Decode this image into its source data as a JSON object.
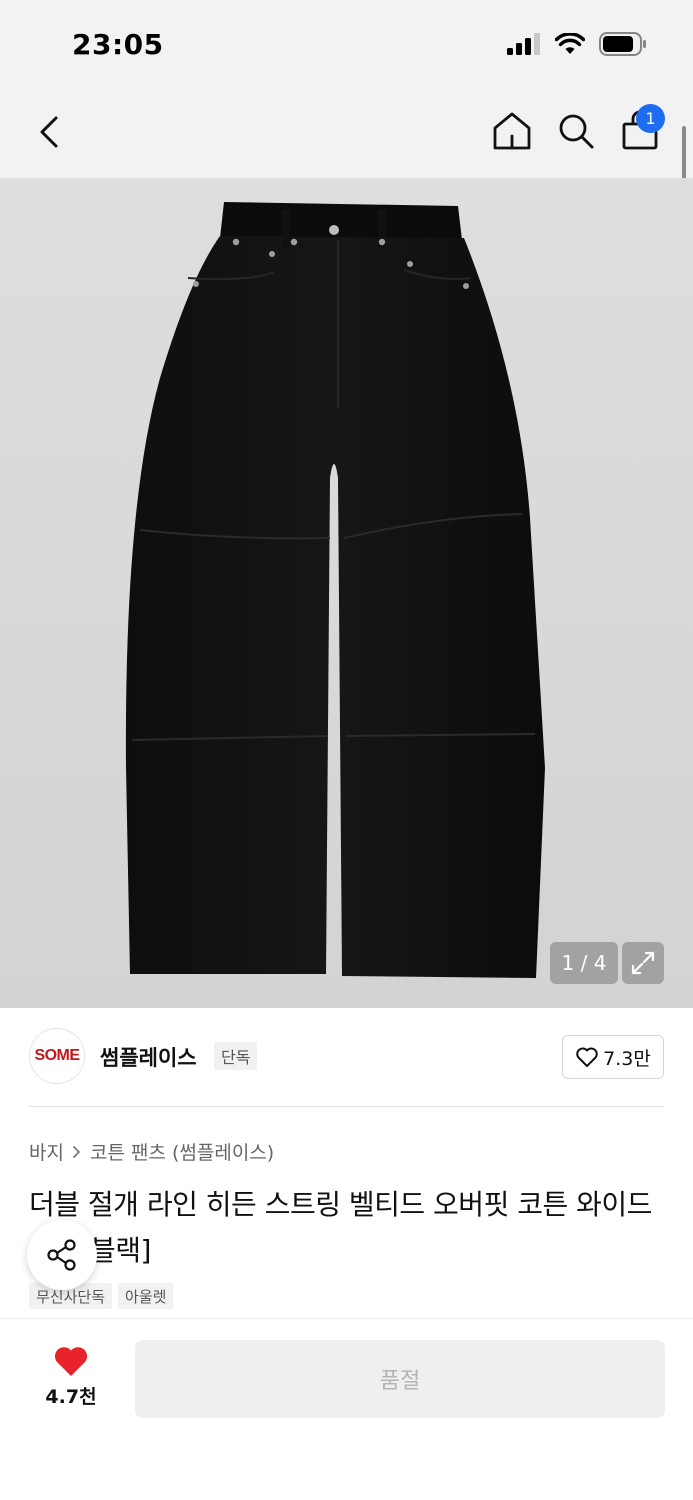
{
  "status_bar": {
    "time": "23:05"
  },
  "nav": {
    "cart_badge": "1"
  },
  "gallery": {
    "counter": "1 / 4"
  },
  "brand": {
    "logo_text": "SOME",
    "name": "썸플레이스",
    "tag": "단독",
    "likes": "7.3만"
  },
  "breadcrumb": {
    "category": "바지",
    "subcategory": "코튼 팬츠 (썸플레이스)"
  },
  "product": {
    "title": "더블 절개 라인 히든 스트링 벨티드 오버핏 코튼 와이드 팬츠[블랙]",
    "tags": [
      "무신사단독",
      "아울렛"
    ]
  },
  "bottom": {
    "wish_count": "4.7천",
    "button_label": "품절"
  },
  "colors": {
    "accent": "#1e6cf0",
    "heart": "#e8232c",
    "brand": "#c3161c"
  },
  "icons": [
    "chevron-left-icon",
    "home-icon",
    "search-icon",
    "shopping-bag-icon",
    "expand-icon",
    "heart-outline-icon",
    "share-icon",
    "heart-filled-icon",
    "signal-icon",
    "wifi-icon",
    "battery-icon"
  ]
}
